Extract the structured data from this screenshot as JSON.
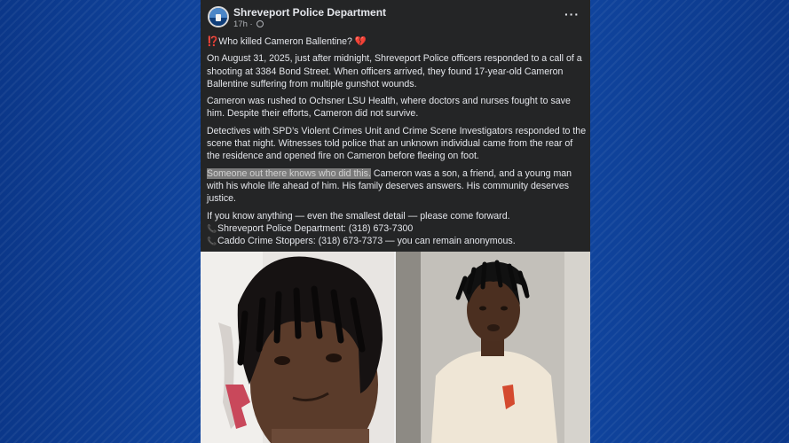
{
  "post": {
    "page_name": "Shreveport Police Department",
    "timestamp": "17h",
    "separator": " · ",
    "title_emoji_start": "⁉️",
    "title": "Who killed Cameron Ballentine?",
    "title_emoji_end": " 💔",
    "paragraphs": [
      "On August 31, 2025, just after midnight, Shreveport Police officers responded to a call of a shooting at 3384 Bond Street. When officers arrived, they found 17-year-old Cameron Ballentine suffering from multiple gunshot wounds.",
      "Cameron was rushed to Ochsner LSU Health, where doctors and nurses fought to save him. Despite their efforts, Cameron did not survive.",
      "Detectives with SPD’s Violent Crimes Unit and Crime Scene Investigators responded to the scene that night. Witnesses told police that an unknown individual came from the rear of the residence and opened fire on Cameron before fleeing on foot."
    ],
    "highlighted": "Someone out there knows who did this.",
    "after_highlight": " Cameron was a son, a friend, and a young man with his whole life ahead of him. His family deserves answers. His community deserves justice.",
    "call_to_action": "If you know anything — even the smallest detail — please come forward.",
    "contacts": [
      "Shreveport Police Department: (318) 673-7300",
      "Caddo Crime Stoppers: (318) 673-7373 — you can remain anonymous."
    ],
    "more_label": "···",
    "phone_icon": "📞"
  },
  "colors": {
    "background": "#0e3f93",
    "card": "#242526",
    "text": "#e4e6eb",
    "muted": "#b0b3b8",
    "highlight": "#7b7b7b"
  }
}
